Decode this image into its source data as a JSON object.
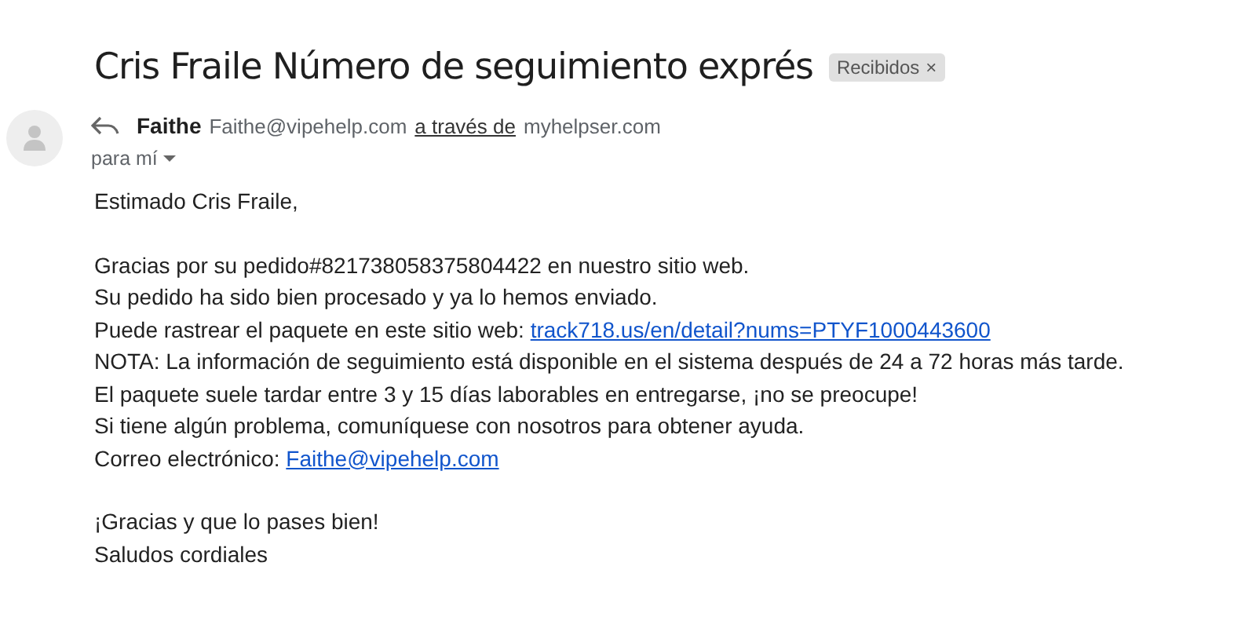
{
  "subject": "Cris Fraile Número de seguimiento exprés",
  "label": {
    "text": "Recibidos",
    "close": "×"
  },
  "sender": {
    "name": "Faithe",
    "email": "Faithe@vipehelp.com",
    "via": "a través de",
    "via_domain": "myhelpser.com"
  },
  "recipient": {
    "text": "para mí"
  },
  "paragraphs": [
    [
      {
        "text": "Estimado Cris Fraile,"
      }
    ],
    [
      {
        "text": "Gracias por su pedido#821738058375804422 en nuestro sitio web."
      },
      {
        "text": "Su pedido ha sido bien procesado y ya lo hemos enviado."
      },
      {
        "text": "Puede rastrear el paquete en este sitio web:",
        "link": "track718.us/en/detail?nums=PTYF1000443600"
      },
      {
        "text": "NOTA: La información de seguimiento está disponible en el sistema después de 24 a 72 horas más tarde."
      },
      {
        "text": "El paquete suele tardar entre 3 y 15 días laborables en entregarse, ¡no se preocupe!"
      },
      {
        "text": "Si tiene algún problema, comuníquese con nosotros para obtener ayuda."
      },
      {
        "text": "Correo electrónico:",
        "link": "Faithe@vipehelp.com"
      }
    ],
    [
      {
        "text": "¡Gracias y que lo pases bien!"
      },
      {
        "text": "Saludos cordiales"
      }
    ]
  ]
}
